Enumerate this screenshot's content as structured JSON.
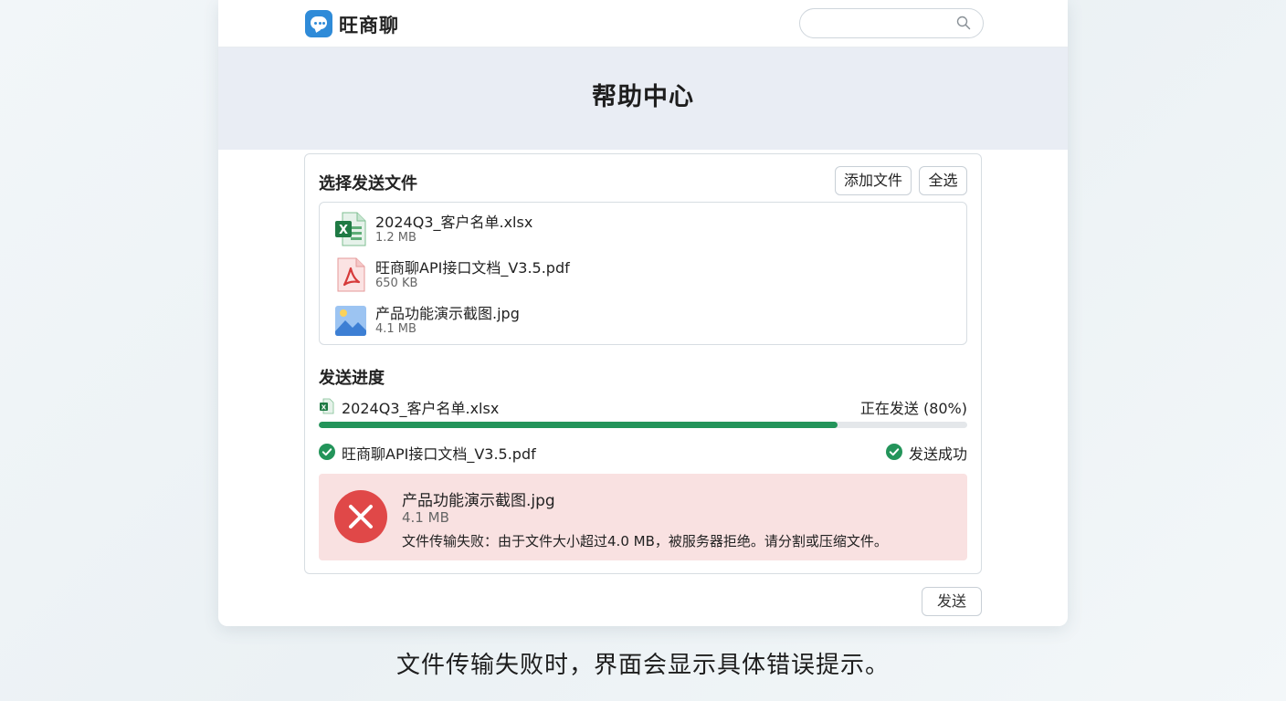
{
  "header": {
    "app_name": "旺商聊",
    "search": {
      "value": "",
      "placeholder": ""
    }
  },
  "hero": {
    "title": "帮助中心"
  },
  "file_select": {
    "title": "选择发送文件",
    "add_button": "添加文件",
    "select_all_button": "全选",
    "files": [
      {
        "name": "2024Q3_客户名单.xlsx",
        "size": "1.2 MB",
        "icon": "excel-file-icon"
      },
      {
        "name": "旺商聊API接口文档_V3.5.pdf",
        "size": "650 KB",
        "icon": "pdf-file-icon"
      },
      {
        "name": "产品功能演示截图.jpg",
        "size": "4.1 MB",
        "icon": "image-file-icon"
      }
    ]
  },
  "progress": {
    "title": "发送进度",
    "items": [
      {
        "name": "2024Q3_客户名单.xlsx",
        "status": "正在发送 (80%)",
        "percent": 80,
        "icon": "excel-file-icon"
      },
      {
        "name": "旺商聊API接口文档_V3.5.pdf",
        "status": "发送成功",
        "icon": "check-circle-icon"
      }
    ],
    "error": {
      "name": "产品功能演示截图.jpg",
      "size": "4.1 MB",
      "message": "文件传输失败：由于文件大小超过4.0 MB，被服务器拒绝。请分割或压缩文件。",
      "icon": "error-circle-icon"
    }
  },
  "send_button": "发送",
  "caption": "文件传输失败时，界面会显示具体错误提示。",
  "colors": {
    "accent": "#2f8bd8",
    "success": "#23945a",
    "error": "#e04848",
    "error_bg": "#f9e1e1"
  }
}
